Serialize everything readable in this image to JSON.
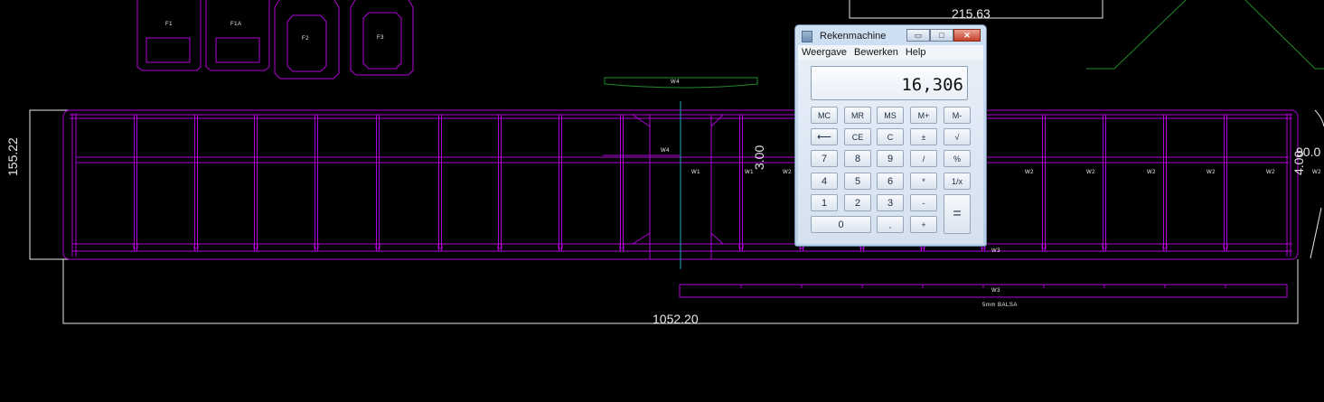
{
  "drawing": {
    "dims": {
      "top": "215.63",
      "left": "155.22",
      "bottom": "1052.20",
      "center": "3.00",
      "right_a": "4.00",
      "right_b": "90.0"
    },
    "formers": [
      "F1",
      "F1A",
      "F2",
      "F3"
    ],
    "labels": {
      "w4_top": "W4",
      "w4_mid": "W4",
      "w1": "W1",
      "w2": "W2",
      "w3": "W3",
      "balsa": "5mm BALSA"
    },
    "colors": {
      "magenta": "#b000d8",
      "green": "#1f8a2a",
      "cyan": "#14a7b8",
      "white": "#e8e8e8"
    }
  },
  "calculator": {
    "title": "Rekenmachine",
    "menu": [
      "Weergave",
      "Bewerken",
      "Help"
    ],
    "display": "16,306",
    "keys": {
      "mc": "MC",
      "mr": "MR",
      "ms": "MS",
      "mplus": "M+",
      "mminus": "M-",
      "back": "⟵",
      "ce": "CE",
      "c": "C",
      "pm": "±",
      "sqrt": "√",
      "k7": "7",
      "k8": "8",
      "k9": "9",
      "div": "/",
      "pct": "%",
      "k4": "4",
      "k5": "5",
      "k6": "6",
      "mul": "*",
      "inv": "1/x",
      "k1": "1",
      "k2": "2",
      "k3": "3",
      "minus": "-",
      "eq": "=",
      "k0": "0",
      "dot": ",",
      "plus": "+"
    }
  }
}
